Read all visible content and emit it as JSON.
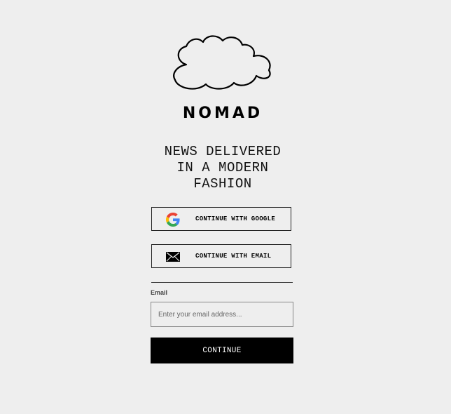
{
  "brand": {
    "logo_icon": "cloud-icon",
    "name": "NOMAD"
  },
  "tagline": {
    "lines": [
      "NEWS DELIVERED",
      "IN A MODERN",
      "FASHION"
    ]
  },
  "auth": {
    "google": {
      "icon": "google-icon",
      "label": "CONTINUE WITH GOOGLE"
    },
    "email": {
      "icon": "envelope-icon",
      "label": "CONTINUE WITH EMAIL"
    }
  },
  "form": {
    "email_label": "Email",
    "email_placeholder": "Enter your email address...",
    "email_value": "",
    "submit_label": "CONTINUE"
  },
  "colors": {
    "background": "#eeeeee",
    "primary_button": "#000000",
    "google_blue": "#4285F4",
    "google_red": "#EA4335",
    "google_yellow": "#FBBC05",
    "google_green": "#34A853"
  }
}
